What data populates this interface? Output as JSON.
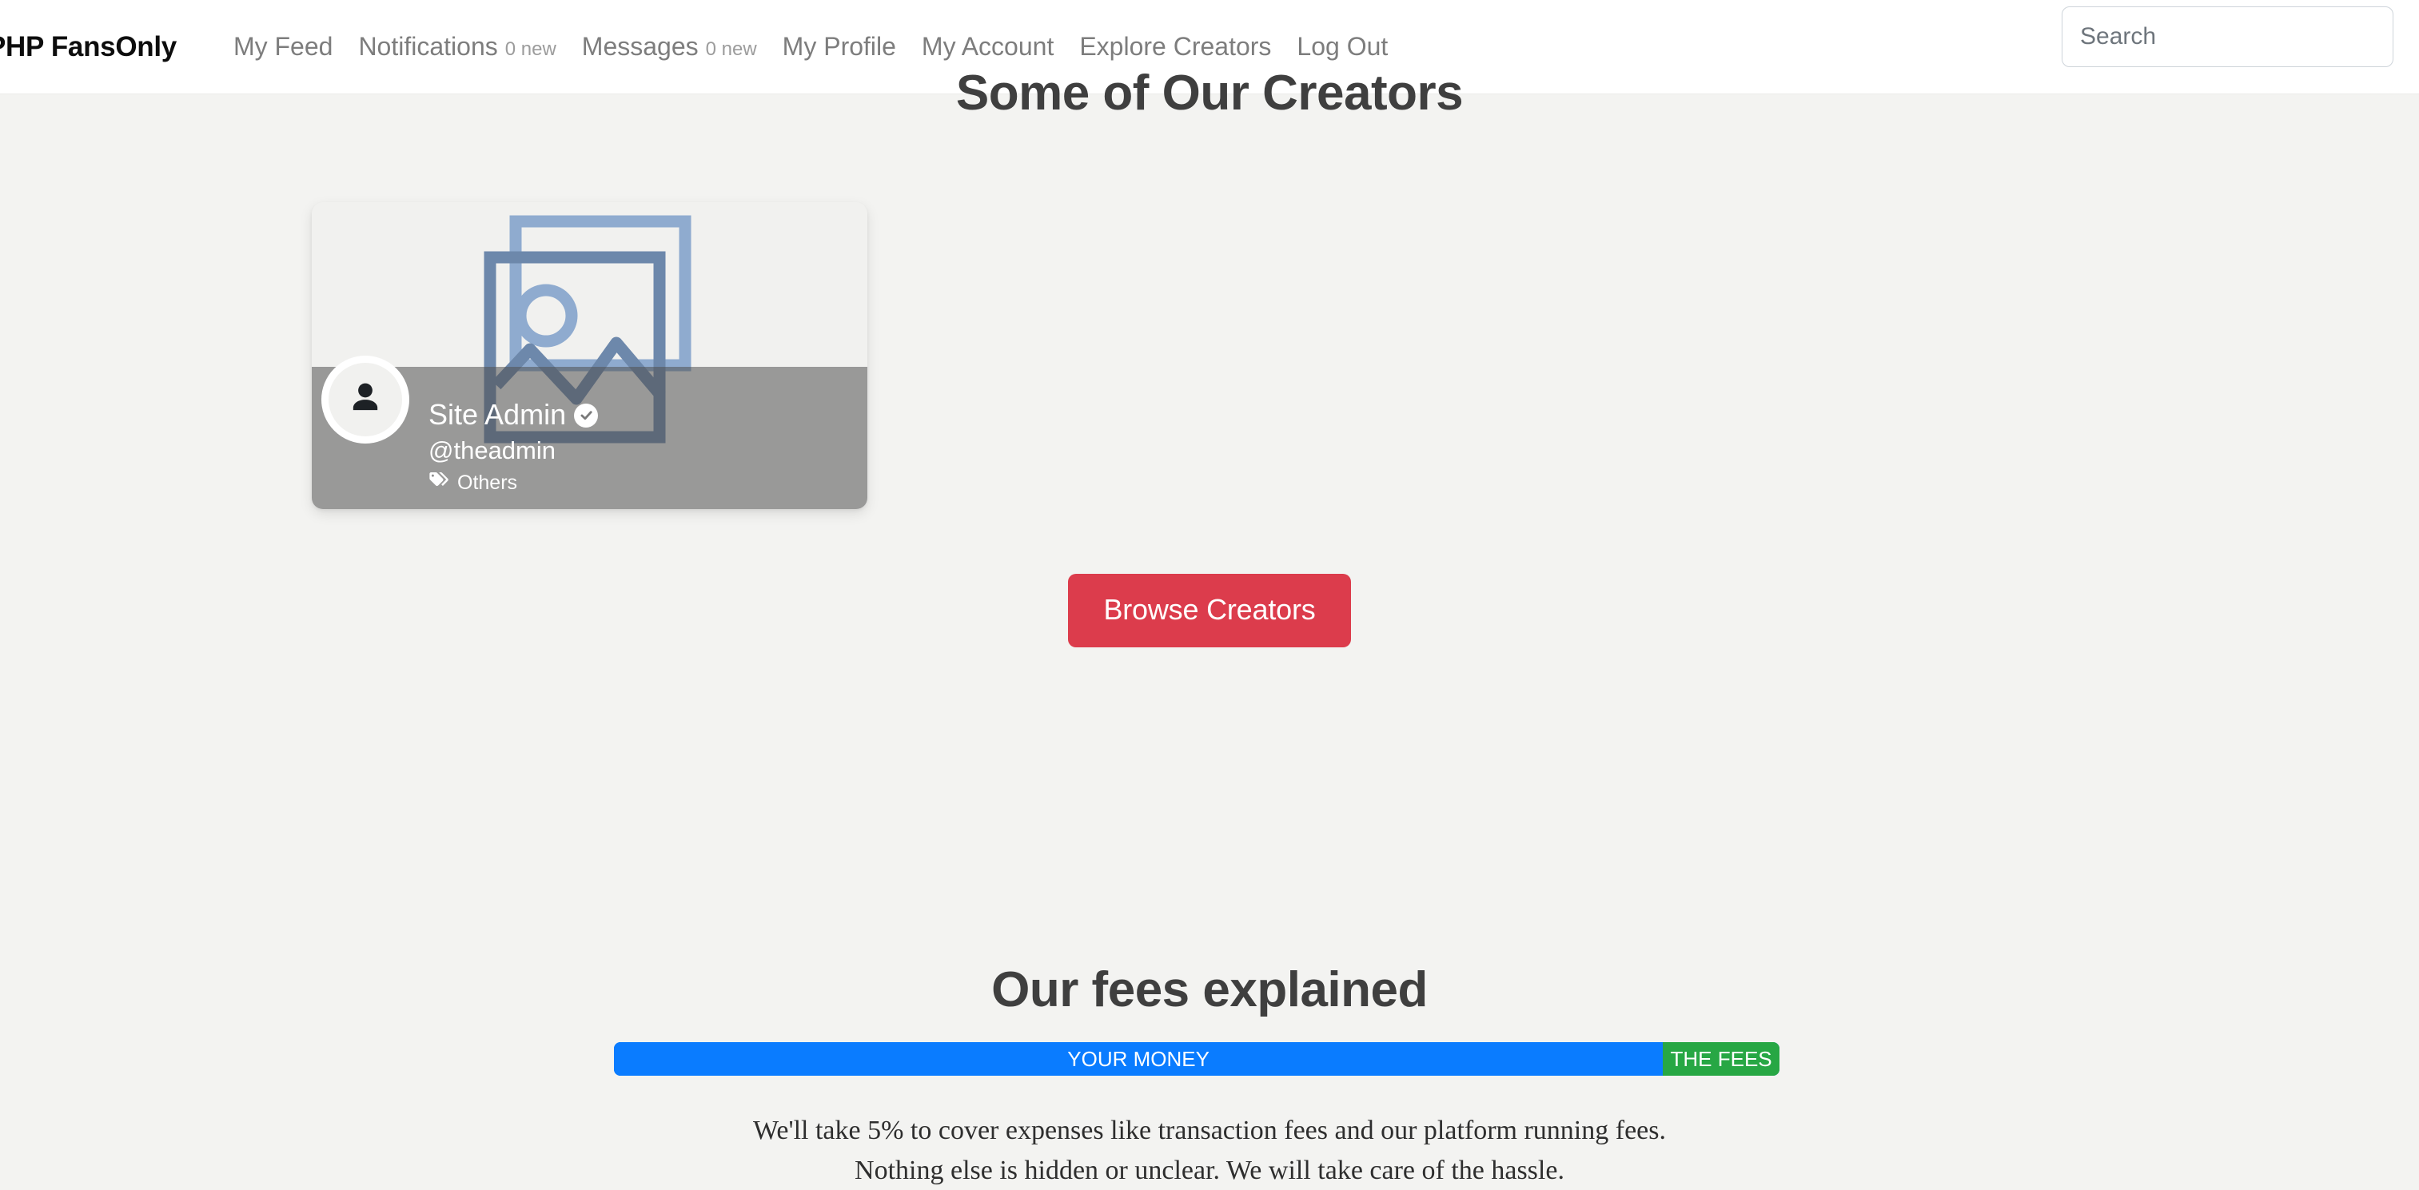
{
  "brand": "PHP FansOnly",
  "nav": {
    "items": [
      {
        "label": "My Feed",
        "badge": ""
      },
      {
        "label": "Notifications",
        "badge": "0 new"
      },
      {
        "label": "Messages",
        "badge": "0 new"
      },
      {
        "label": "My Profile",
        "badge": ""
      },
      {
        "label": "My Account",
        "badge": ""
      },
      {
        "label": "Explore Creators",
        "badge": ""
      },
      {
        "label": "Log Out",
        "badge": ""
      }
    ]
  },
  "search": {
    "placeholder": "Search",
    "value": ""
  },
  "creators_section": {
    "title": "Some of Our Creators",
    "cards": [
      {
        "name": "Site Admin",
        "handle": "@theadmin",
        "category": "Others",
        "verified": true
      }
    ],
    "browse_label": "Browse Creators"
  },
  "fees_section": {
    "title": "Our fees explained",
    "bar": {
      "your_money_label": "YOUR MONEY",
      "your_money_percent": 90,
      "fees_label": "THE FEES",
      "fees_percent": 10,
      "your_money_color": "#0a7cff",
      "fees_color": "#27a744"
    },
    "line1": "We'll take 5% to cover expenses like transaction fees and our platform running fees.",
    "line2": "Nothing else is hidden or unclear. We will take care of the hassle."
  },
  "colors": {
    "accent_red": "#dc3c4c",
    "page_bg": "#f3f3f1",
    "navbar_bg": "#ffffff"
  }
}
